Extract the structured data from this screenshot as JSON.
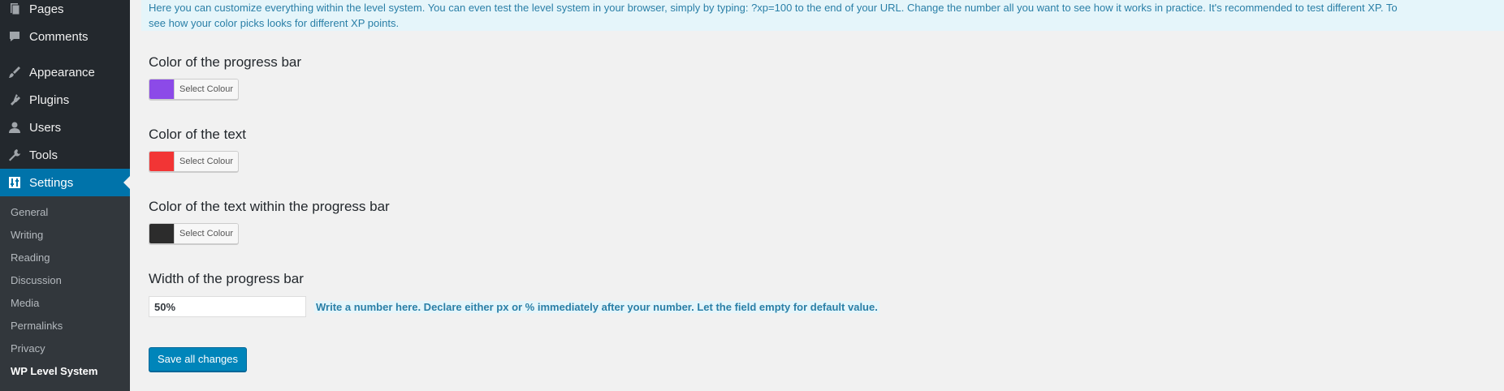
{
  "sidebar": {
    "items": [
      {
        "label": "Pages",
        "icon": "pages-icon"
      },
      {
        "label": "Comments",
        "icon": "comments-icon"
      },
      {
        "label": "Appearance",
        "icon": "appearance-icon"
      },
      {
        "label": "Plugins",
        "icon": "plugins-icon"
      },
      {
        "label": "Users",
        "icon": "users-icon"
      },
      {
        "label": "Tools",
        "icon": "tools-icon"
      },
      {
        "label": "Settings",
        "icon": "settings-icon",
        "active": true
      }
    ],
    "submenu": [
      {
        "label": "General"
      },
      {
        "label": "Writing"
      },
      {
        "label": "Reading"
      },
      {
        "label": "Discussion"
      },
      {
        "label": "Media"
      },
      {
        "label": "Permalinks"
      },
      {
        "label": "Privacy"
      },
      {
        "label": "WP Level System",
        "current": true
      }
    ]
  },
  "main": {
    "notice_line1": "Here you can customize everything within the level system. You can even test the level system in your browser, simply by typing: ?xp=100 to the end of your URL. Change the number all you want to see how it works in practice. It's recommended to test different XP. To",
    "notice_line2": "see how your color picks looks for different XP points.",
    "fields": [
      {
        "title": "Color of the progress bar",
        "button_label": "Select Colour",
        "color": "#8c4ae8"
      },
      {
        "title": "Color of the text",
        "button_label": "Select Colour",
        "color": "#f23535"
      },
      {
        "title": "Color of the text within the progress bar",
        "button_label": "Select Colour",
        "color": "#2c2c2c"
      }
    ],
    "width_field": {
      "title": "Width of the progress bar",
      "value": "50%",
      "hint": "Write a number here. Declare either px or % immediately after your number. Let the field empty for default value."
    },
    "save_label": "Save all changes"
  },
  "colors": {
    "sidebar_bg": "#23282d",
    "submenu_bg": "#32373c",
    "accent": "#0073aa",
    "notice_bg": "#e5f5fa",
    "notice_text": "#2a7fa7",
    "button_primary": "#0085ba"
  }
}
